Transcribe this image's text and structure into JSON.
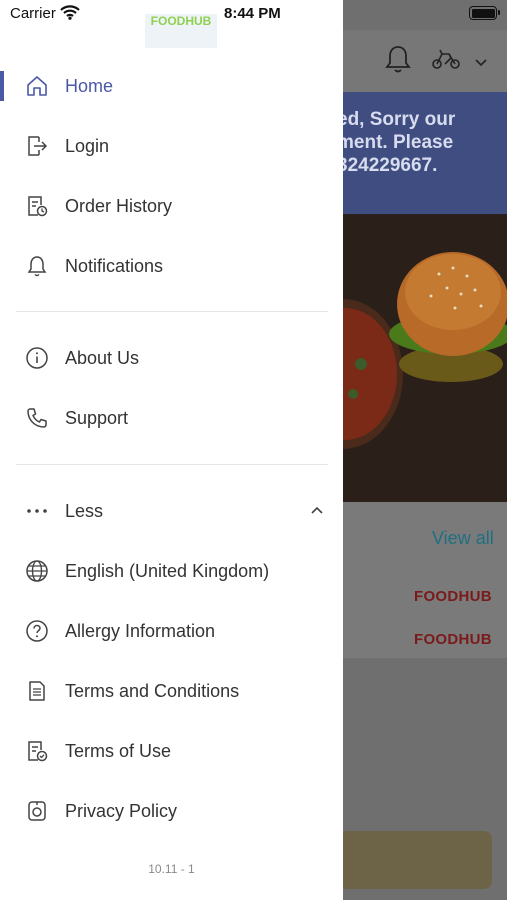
{
  "status": {
    "carrier": "Carrier",
    "time": "8:44 PM"
  },
  "brand_peek": "FOODHUB",
  "menu": {
    "primary": [
      {
        "label": "Home",
        "icon": "home-icon",
        "active": true
      },
      {
        "label": "Login",
        "icon": "login-icon"
      },
      {
        "label": "Order History",
        "icon": "order-history-icon"
      },
      {
        "label": "Notifications",
        "icon": "bell-icon"
      }
    ],
    "secondary": [
      {
        "label": "About Us",
        "icon": "info-icon"
      },
      {
        "label": "Support",
        "icon": "phone-icon"
      }
    ],
    "less_label": "Less",
    "more": [
      {
        "label": "English (United Kingdom)",
        "icon": "globe-icon"
      },
      {
        "label": "Allergy Information",
        "icon": "question-icon"
      },
      {
        "label": "Terms and Conditions",
        "icon": "document-icon"
      },
      {
        "label": "Terms of Use",
        "icon": "document-check-icon"
      },
      {
        "label": "Privacy Policy",
        "icon": "privacy-icon"
      }
    ]
  },
  "version": "10.11 - 1",
  "background": {
    "banner_lines": [
      "ed, Sorry our",
      "ment. Please",
      "324229667."
    ],
    "view_all": "View all",
    "brand_labels": [
      "FOODHUB",
      "FOODHUB"
    ]
  },
  "colors": {
    "accent": "#4a58a6",
    "text": "#333333",
    "divider": "#e6e6e6"
  }
}
